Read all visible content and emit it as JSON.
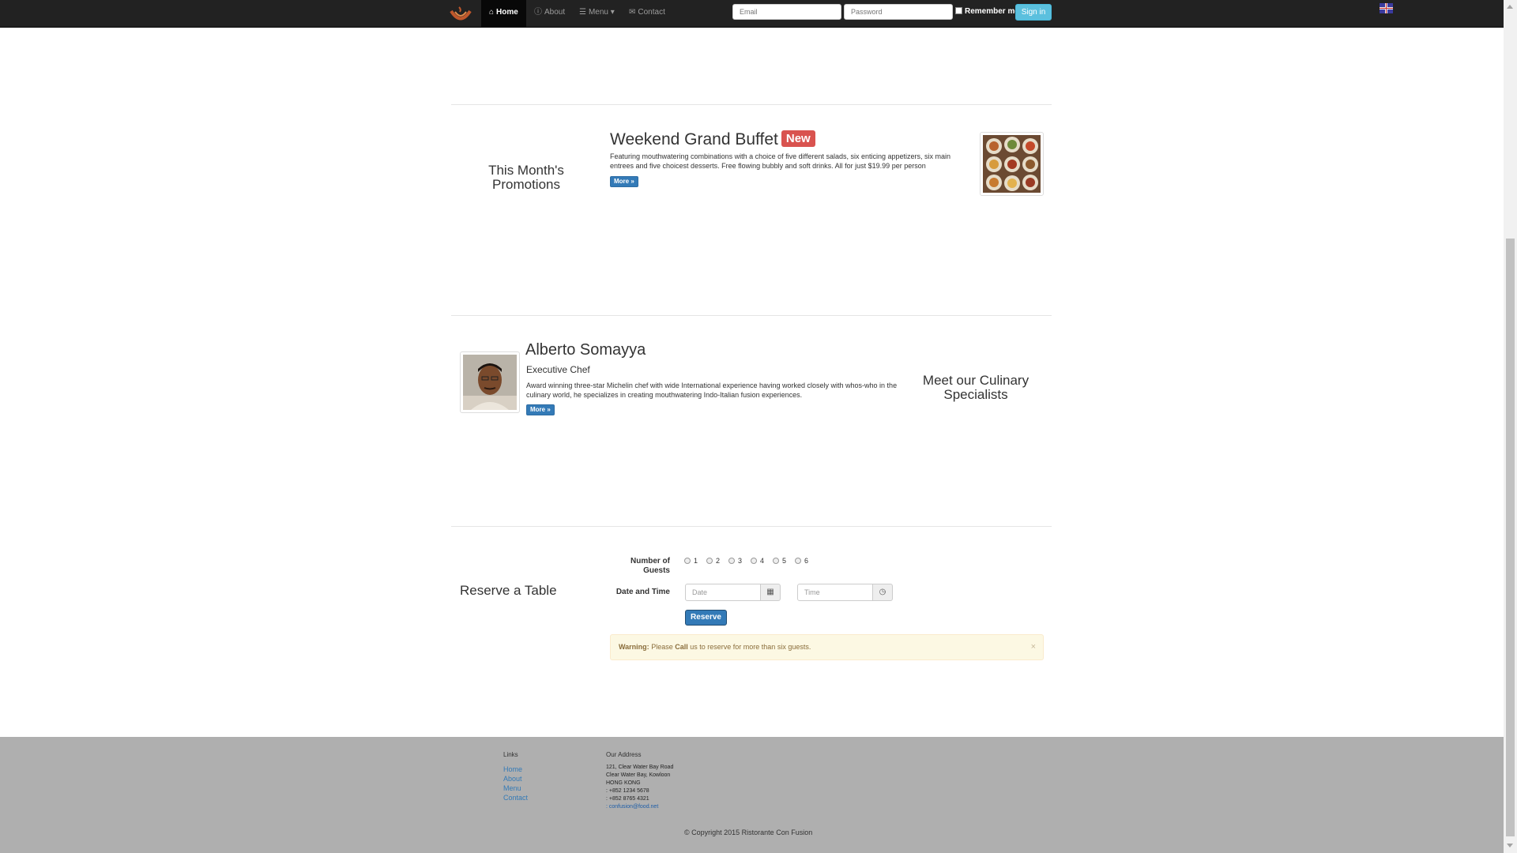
{
  "navbar": {
    "home": "Home",
    "about": "About",
    "menu": "Menu",
    "menu_caret": "▾",
    "contact": "Contact",
    "email_placeholder": "Email",
    "password_placeholder": "Password",
    "remember_label": "Remember me",
    "signin_label": "Sign in"
  },
  "promotion": {
    "heading": "This Month's Promotions",
    "title": "Weekend Grand Buffet",
    "badge": "New",
    "description": "Featuring mouthwatering combinations with a choice of five different salads, six enticing appetizers, six main entrees and five choicest desserts. Free flowing bubbly and soft drinks. All for just $19.99 per person",
    "more_label": "More »"
  },
  "chef": {
    "heading": "Meet our Culinary Specialists",
    "name": "Alberto Somayya",
    "role": "Executive Chef",
    "description": "Award winning three-star Michelin chef with wide International experience having worked closely with whos-who in the culinary world, he specializes in creating mouthwatering Indo-Italian fusion experiences.",
    "more_label": "More »"
  },
  "reserve": {
    "heading": "Reserve a Table",
    "guests_label": "Number of Guests",
    "guest_options": [
      "1",
      "2",
      "3",
      "4",
      "5",
      "6"
    ],
    "datetime_label": "Date and Time",
    "date_placeholder": "Date",
    "time_placeholder": "Time",
    "reserve_label": "Reserve",
    "warning_strong": "Warning:",
    "warning_pre": "Please",
    "warning_call": "Call",
    "warning_post": "us to reserve for more than six guests.",
    "close": "×"
  },
  "footer": {
    "links_heading": "Links",
    "links": [
      "Home",
      "About",
      "Menu",
      "Contact"
    ],
    "address_heading": "Our Address",
    "address_lines": [
      "121, Clear Water Bay Road",
      "Clear Water Bay, Kowloon",
      "HONG KONG"
    ],
    "phone": ": +852 1234 5678",
    "fax": ": +852 8765 4321",
    "email": ": confusion@food.net",
    "copyright": "© Copyright 2015 Ristorante Con Fusion"
  },
  "colors": {
    "navbar_bg": "#222222",
    "primary": "#337ab7",
    "info": "#5bc0de",
    "danger": "#d9534f",
    "warning_bg": "#fcf8e3",
    "footer_bg": "#afafaf"
  },
  "icons": {
    "home": "home-icon",
    "about": "info-icon",
    "menu": "list-icon",
    "contact": "envelope-icon",
    "date": "calendar-icon",
    "time": "clock-icon"
  }
}
